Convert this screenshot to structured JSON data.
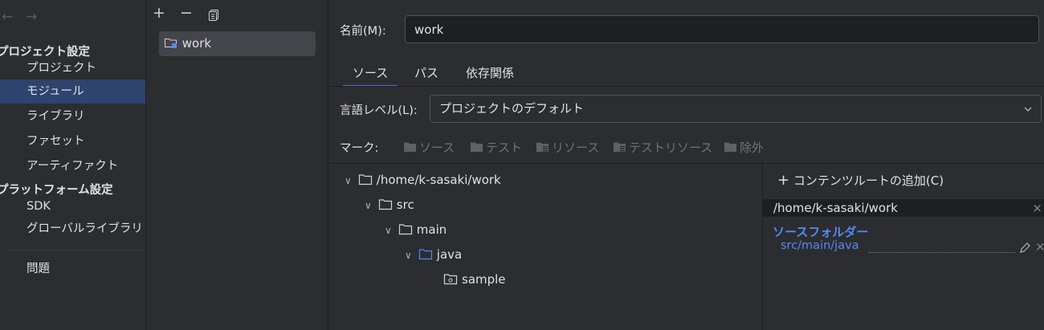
{
  "nav": {
    "back": "←",
    "forward": "→",
    "project_settings": "プロジェクト設定",
    "platform_settings": "プラットフォーム設定",
    "items": [
      "プロジェクト",
      "モジュール",
      "ライブラリ",
      "ファセット",
      "アーティファクト"
    ],
    "platform_items": [
      "SDK",
      "グローバルライブラリ"
    ],
    "problems": "問題"
  },
  "modules": {
    "add": "+",
    "remove": "−",
    "item": "work"
  },
  "name": {
    "label": "名前(M):",
    "value": "work"
  },
  "tabs": [
    "ソース",
    "パス",
    "依存関係"
  ],
  "language": {
    "label": "言語レベル(L):",
    "value": "プロジェクトのデフォルト"
  },
  "mark": {
    "label": "マーク:",
    "items": [
      "ソース",
      "テスト",
      "リソース",
      "テストリソース",
      "除外"
    ]
  },
  "tree": [
    {
      "label": "/home/k-sasaki/work",
      "level": 0,
      "icon": "folder-icon"
    },
    {
      "label": "src",
      "level": 1,
      "icon": "folder-icon"
    },
    {
      "label": "main",
      "level": 2,
      "icon": "folder-icon"
    },
    {
      "label": "java",
      "level": 3,
      "icon": "source-folder-icon"
    },
    {
      "label": "sample",
      "level": 4,
      "icon": "package-icon"
    }
  ],
  "roots": {
    "add_label": "コンテンツルートの追加(C)",
    "path": "/home/k-sasaki/work",
    "source_header": "ソースフォルダー",
    "source_path": "src/main/java",
    "close": "×"
  },
  "colors": {
    "background": "#2b2d30",
    "selection": "#2e436e",
    "accent_blue": "#548af7"
  }
}
